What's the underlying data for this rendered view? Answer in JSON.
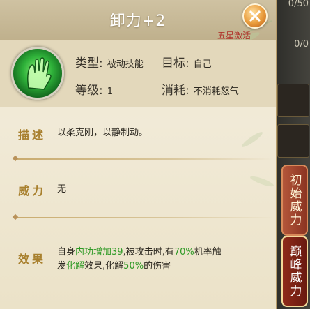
{
  "background": {
    "counter_top": "0/50",
    "counter_mid": "0/0"
  },
  "popup": {
    "title": "卸力+2",
    "star_activate": "五星激活",
    "close_icon": "close-x-icon",
    "skill_icon": "green-palm-icon",
    "info": {
      "type_label": "类型:",
      "type_value": "被动技能",
      "target_label": "目标:",
      "target_value": "自己",
      "level_label": "等级:",
      "level_value": "1",
      "cost_label": "消耗:",
      "cost_value": "不消耗怒气"
    },
    "description": {
      "label": "描述",
      "text": "以柔克刚，以静制动。"
    },
    "power": {
      "label": "威力",
      "text": "无"
    },
    "effect": {
      "label": "效果",
      "line1_a": "自身",
      "line1_hl1": "内功增加39",
      "line1_b": ",被攻击时,有",
      "line1_hl2": "70%",
      "line1_c": "机率触",
      "line2_a": "发",
      "line2_hl1": "化解",
      "line2_b": "效果,化解",
      "line2_hl2": "50%",
      "line2_c": "的伤害"
    }
  },
  "tabs": {
    "initial_power": "初始威力",
    "peak_power": "巅峰威力"
  },
  "colors": {
    "highlight_green": "#2f9a26",
    "star_red": "#b0342c",
    "label_gold": "#a8802e"
  }
}
